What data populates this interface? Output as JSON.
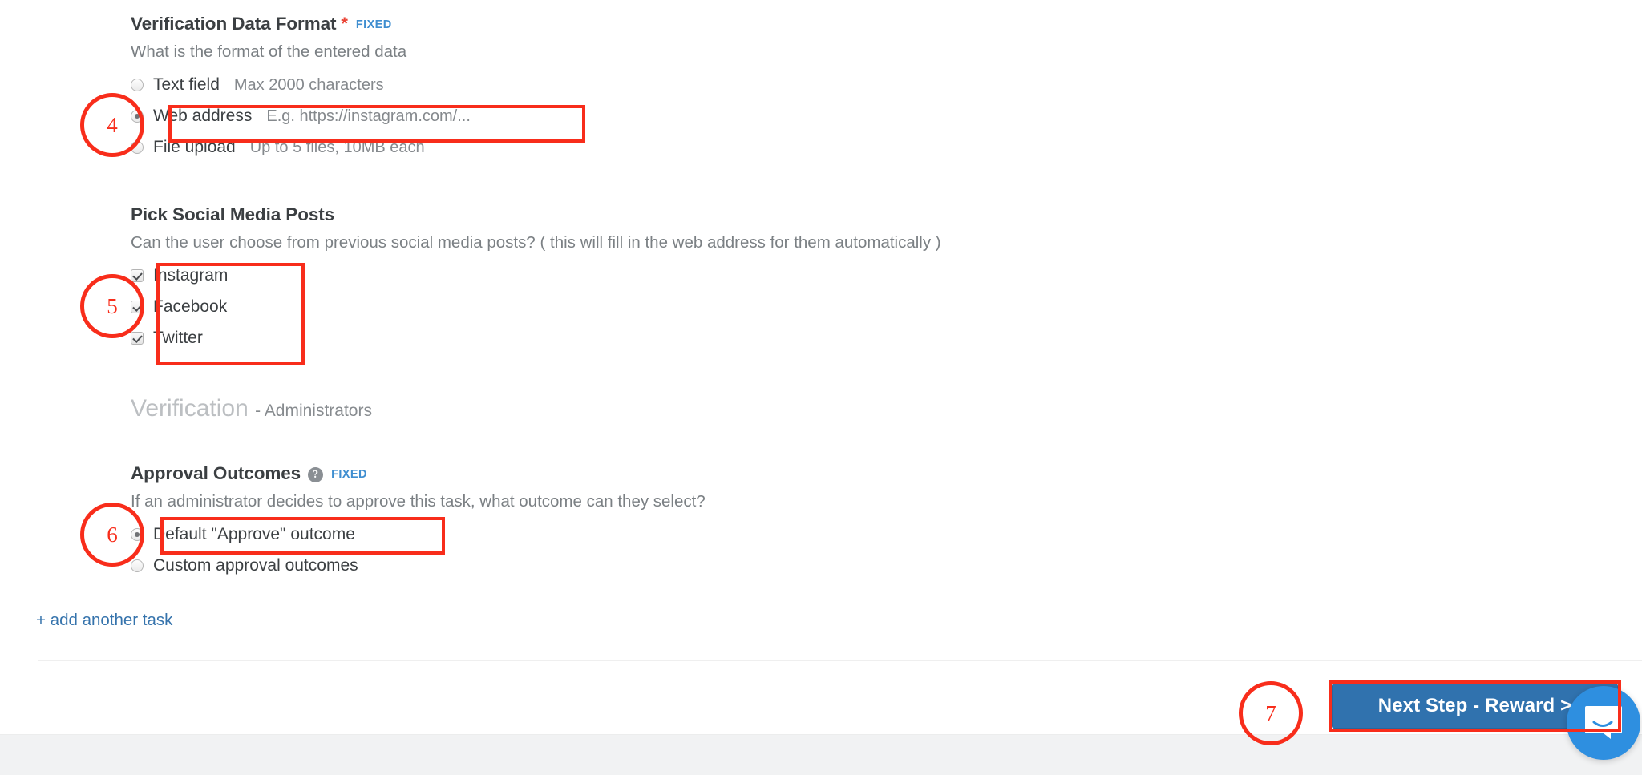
{
  "sections": [
    {
      "id": "verification-data-format",
      "title": "Verification Data Format",
      "required_marker": "*",
      "badge": "FIXED",
      "description": "What is the format of the entered data",
      "options": [
        {
          "label": "Text field",
          "hint": "Max 2000 characters",
          "selected": false
        },
        {
          "label": "Web address",
          "hint": "E.g. https://instagram.com/...",
          "selected": true
        },
        {
          "label": "File upload",
          "hint": "Up to 5 files, 10MB each",
          "selected": false
        }
      ]
    },
    {
      "id": "pick-social-media-posts",
      "title": "Pick Social Media Posts",
      "description": "Can the user choose from previous social media posts? ( this will fill in the web address for them automatically )",
      "checkboxes": [
        {
          "label": "Instagram",
          "checked": true
        },
        {
          "label": "Facebook",
          "checked": true
        },
        {
          "label": "Twitter",
          "checked": true
        }
      ]
    }
  ],
  "admin_section": {
    "heading": "Verification",
    "heading_sub": "- Administrators",
    "title": "Approval Outcomes",
    "help_icon": "question-mark-icon",
    "badge": "FIXED",
    "description": "If an administrator decides to approve this task, what outcome can they select?",
    "options": [
      {
        "label": "Default \"Approve\" outcome",
        "selected": true
      },
      {
        "label": "Custom approval outcomes",
        "selected": false
      }
    ]
  },
  "add_task_link": "+ add another task",
  "footer": {
    "next_button": "Next Step - Reward >"
  },
  "intercom": {
    "icon": "chat-bubble-icon"
  },
  "annotations": {
    "markers": [
      {
        "number": "4"
      },
      {
        "number": "5"
      },
      {
        "number": "6"
      },
      {
        "number": "7"
      }
    ],
    "color": "#f82d1b"
  }
}
